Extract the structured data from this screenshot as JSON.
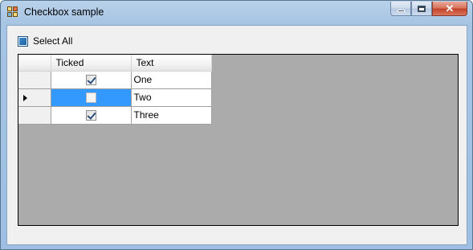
{
  "window": {
    "title": "Checkbox sample",
    "icon": "form-app-icon"
  },
  "caption_buttons": {
    "minimize": "minimize-icon",
    "maximize": "maximize-icon",
    "close": "close-icon",
    "close_glyph": "✕"
  },
  "select_all": {
    "label": "Select All",
    "state": "indeterminate"
  },
  "grid": {
    "columns": [
      "Ticked",
      "Text"
    ],
    "rows": [
      {
        "ticked": true,
        "text": "One",
        "current": false,
        "selected": false
      },
      {
        "ticked": false,
        "text": "Two",
        "current": true,
        "selected": true
      },
      {
        "ticked": true,
        "text": "Three",
        "current": false,
        "selected": false
      }
    ],
    "selection_color": "#3399ff",
    "background_color": "#ababab"
  }
}
